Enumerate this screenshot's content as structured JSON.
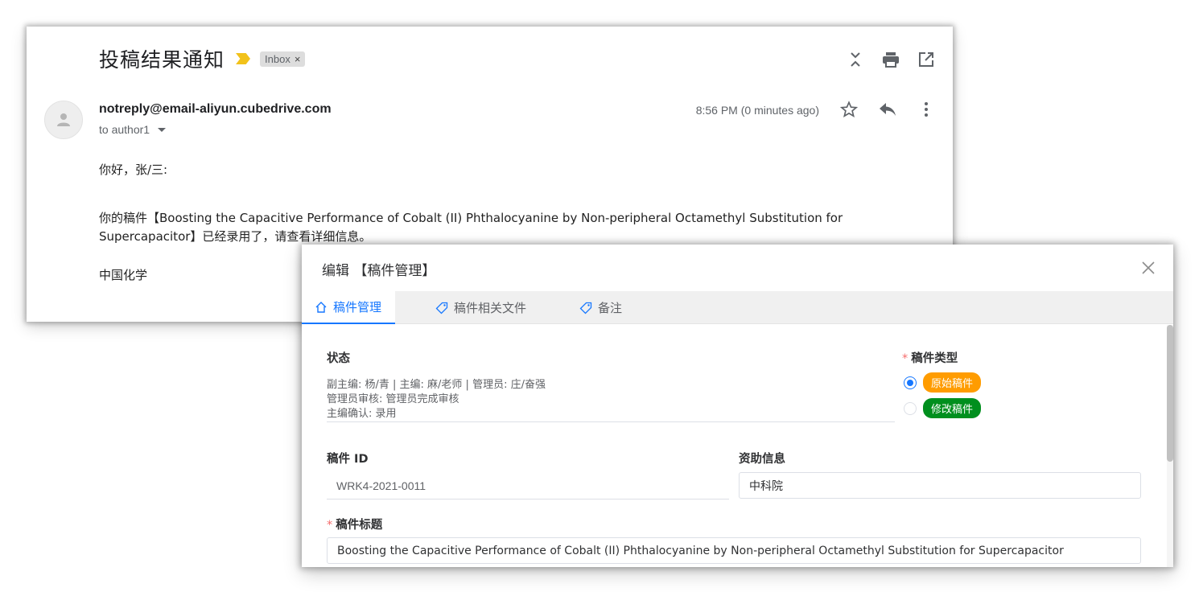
{
  "email": {
    "subject": "投稿结果通知",
    "label": "Inbox",
    "label_close": "×",
    "sender": "notreply@email-aliyun.cubedrive.com",
    "recipient": "to author1",
    "timestamp": "8:56 PM (0 minutes ago)",
    "greeting": "你好，张/三:",
    "paragraph": "你的稿件【Boosting the Capacitive Performance of Cobalt (II) Phthalocyanine by Non-peripheral Octamethyl Substitution for Supercapacitor】已经录用了，请查看详细信息。",
    "signature": "中国化学",
    "icons": [
      "collapse-icon",
      "print-icon",
      "open-in-new-icon",
      "star-icon",
      "reply-icon",
      "more-vert-icon"
    ]
  },
  "dialog": {
    "title": "编辑 【稿件管理】",
    "tabs": [
      {
        "label": "稿件管理",
        "icon": "home-icon"
      },
      {
        "label": "稿件相关文件",
        "icon": "tag-icon"
      },
      {
        "label": "备注",
        "icon": "tag-icon"
      }
    ],
    "status": {
      "label": "状态",
      "lines": [
        "副主编: 杨/青 | 主编: 麻/老师 | 管理员: 庄/奋强",
        "管理员审核: 管理员完成审核",
        "主编确认: 录用"
      ]
    },
    "manuscript_type": {
      "label": "稿件类型",
      "options": [
        {
          "label": "原始稿件",
          "color": "#ff9c00",
          "checked": true
        },
        {
          "label": "修改稿件",
          "color": "#008f1e",
          "checked": false
        }
      ]
    },
    "manuscript_id": {
      "label": "稿件 ID",
      "value": "WRK4-2021-0011"
    },
    "funding": {
      "label": "资助信息",
      "value": "中科院"
    },
    "manuscript_title": {
      "label": "稿件标题",
      "value": "Boosting the Capacitive Performance of Cobalt (II) Phthalocyanine by Non-peripheral Octamethyl Substitution for Supercapacitor"
    },
    "required_mark": "*"
  }
}
